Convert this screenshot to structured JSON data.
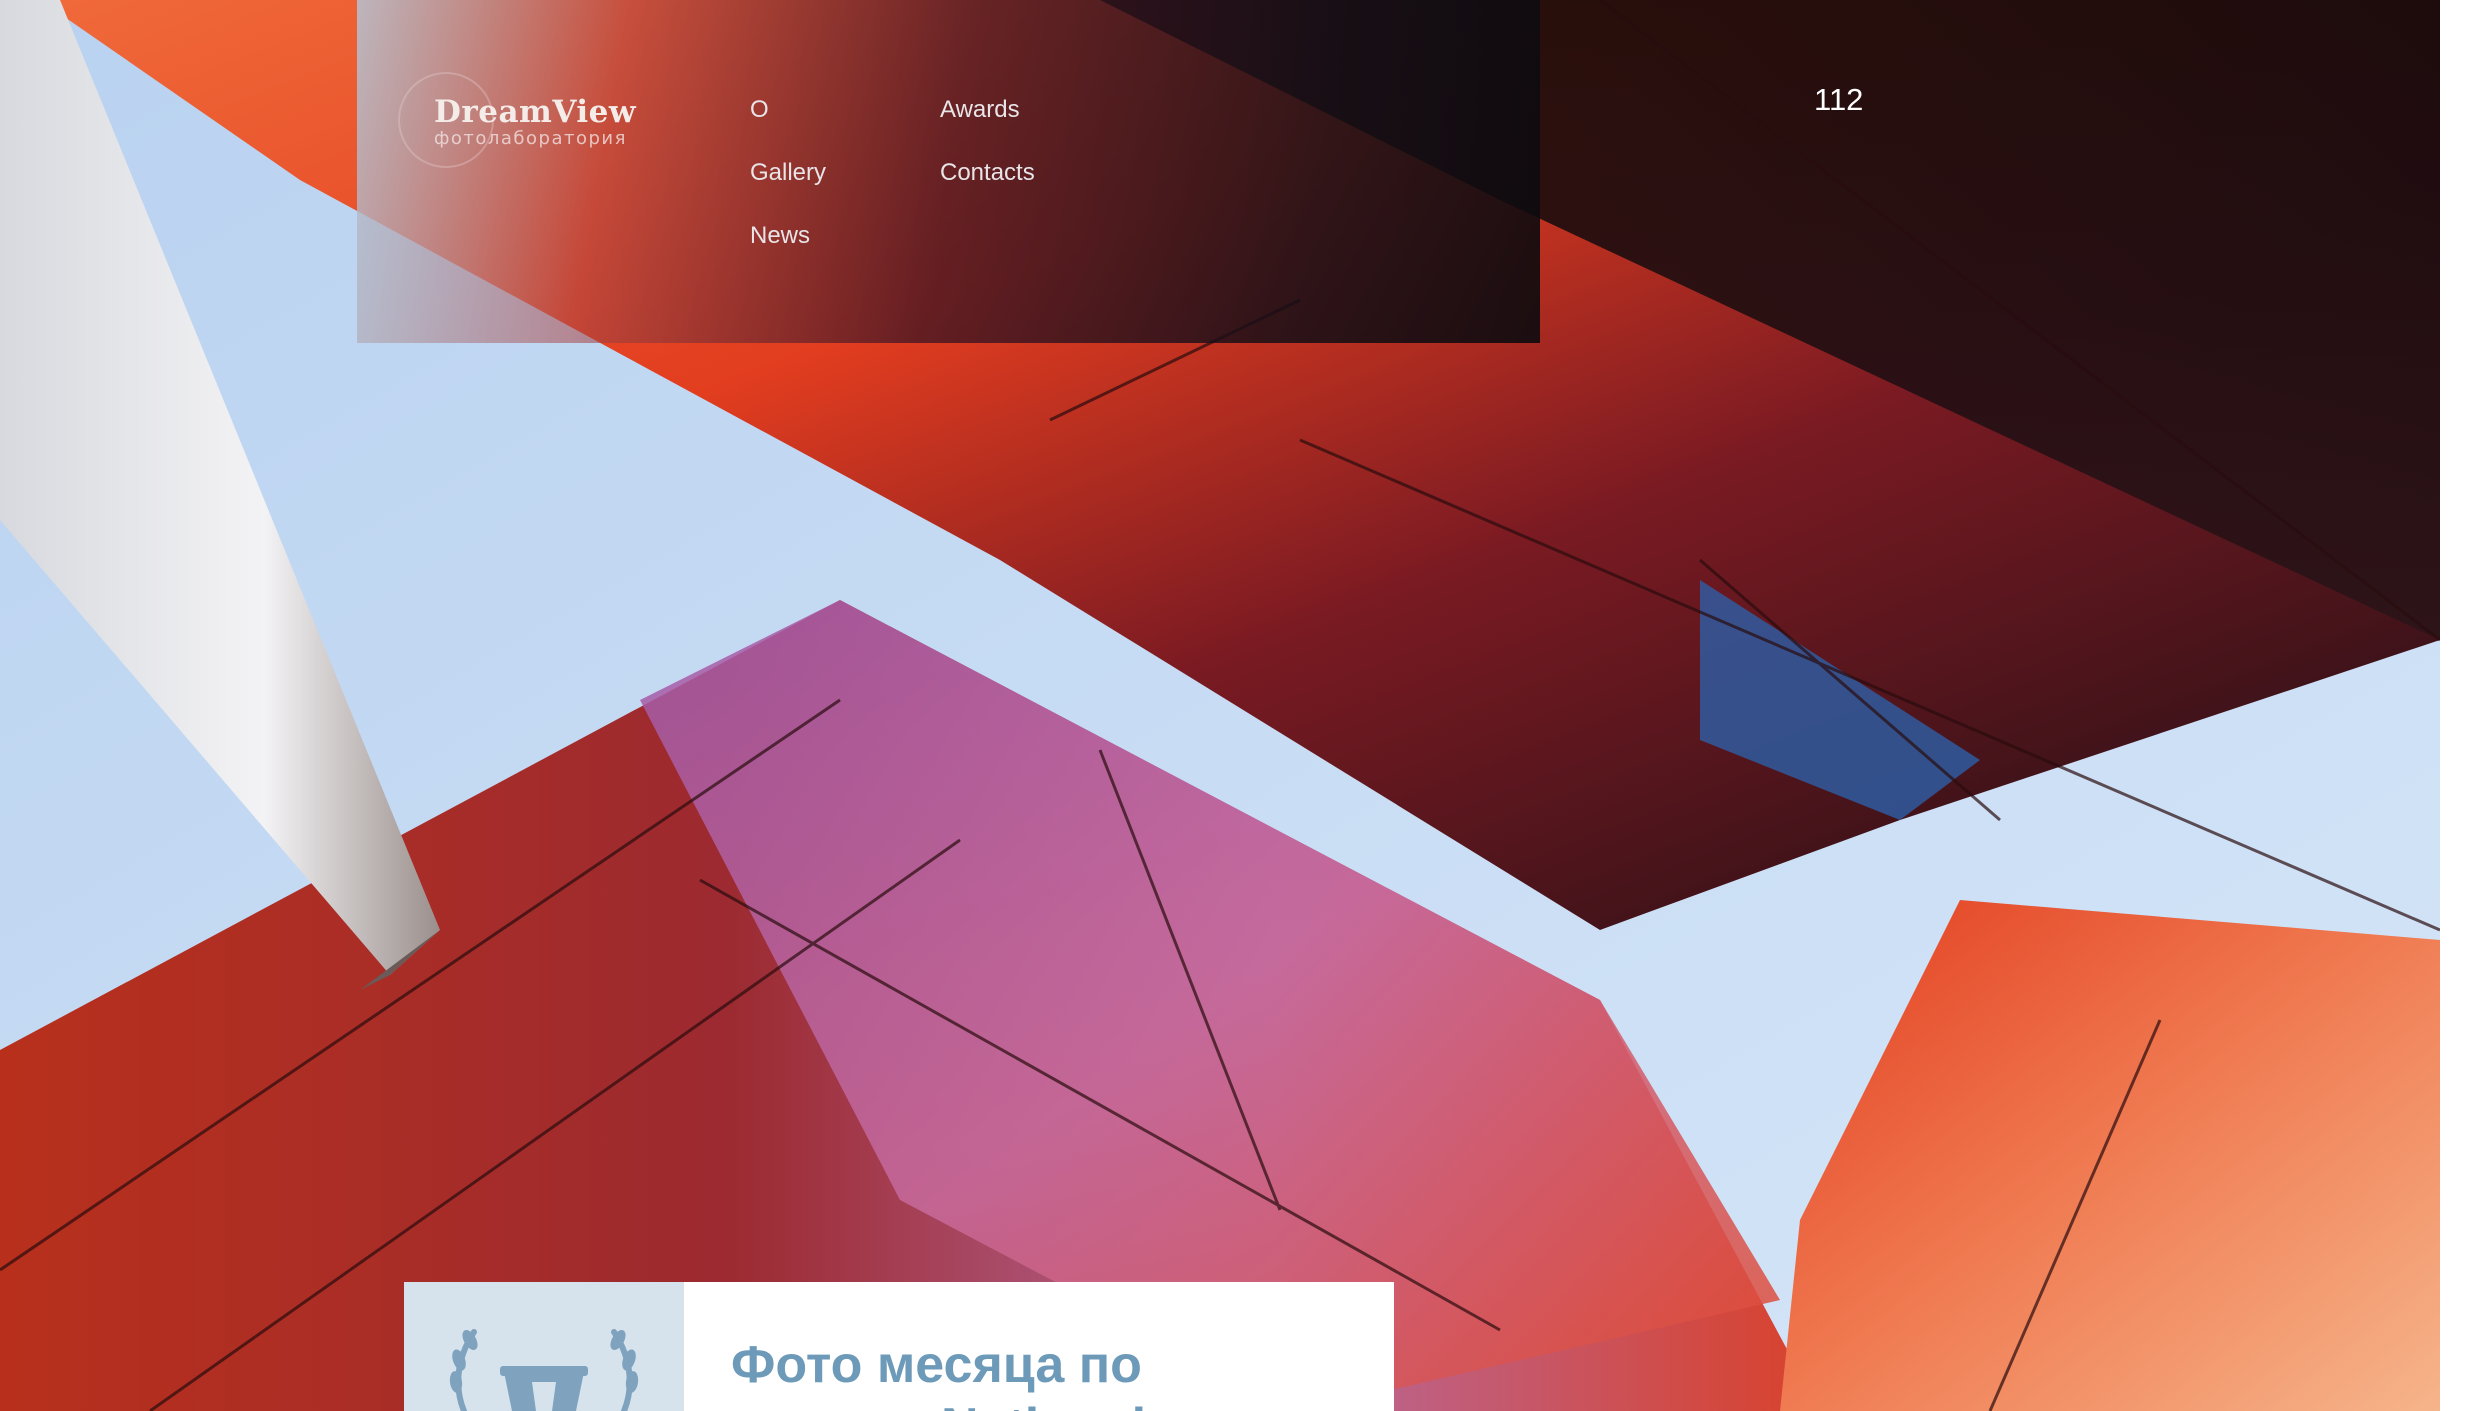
{
  "brand": {
    "name": "DreamView",
    "subtitle": "фотолаборатория"
  },
  "nav": {
    "items": [
      {
        "label": "О"
      },
      {
        "label": "Awards"
      },
      {
        "label": "Gallery"
      },
      {
        "label": "Contacts"
      },
      {
        "label": "News"
      }
    ]
  },
  "counter": "112",
  "card": {
    "title": "Фото месяца по",
    "title_continued": "National",
    "icon": "trophy-laurel-icon"
  },
  "colors": {
    "card_title": "#6d9ab8",
    "accent_red": "#d9361f"
  }
}
